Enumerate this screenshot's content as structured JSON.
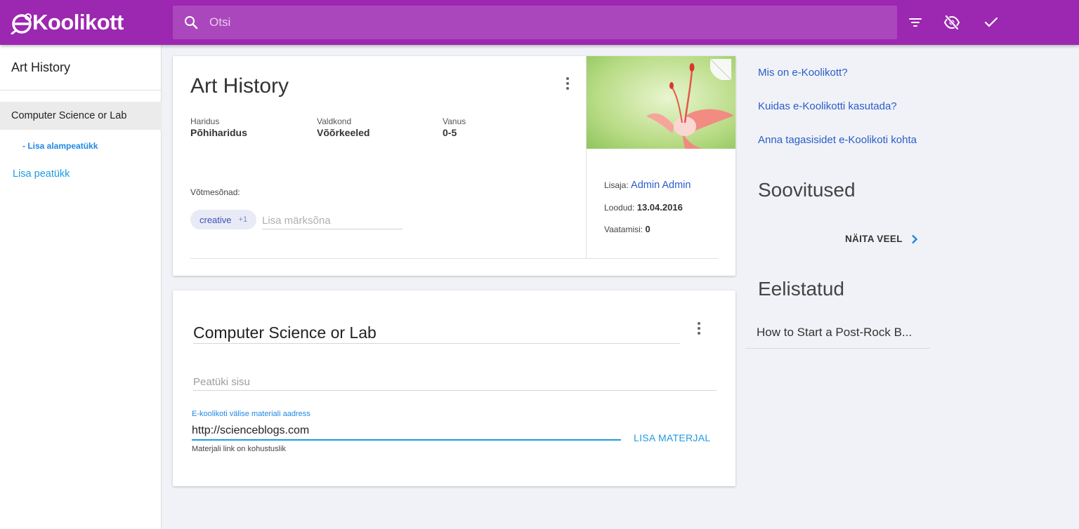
{
  "header": {
    "logo_text": "Koolikott",
    "search_placeholder": "Otsi",
    "colors": {
      "primary": "#9c27b0",
      "search_bg": "#ab47bc"
    },
    "icons": [
      "search-icon",
      "filter-icon",
      "visibility-off-icon",
      "check-icon"
    ]
  },
  "sidebar": {
    "title": "Art History",
    "chapter": "Computer Science or Lab",
    "add_subchapter": "- Lisa alampeatükk",
    "add_chapter": "Lisa peatükk"
  },
  "material": {
    "title": "Art History",
    "fields": [
      {
        "label": "Haridus",
        "value": "Põhiharidus"
      },
      {
        "label": "Valdkond",
        "value": "Võõrkeeled"
      },
      {
        "label": "Vanus",
        "value": "0-5"
      }
    ],
    "keywords_label": "Võtmesõnad:",
    "keyword_chip": "creative",
    "keyword_more": "+1",
    "keyword_placeholder": "Lisa märksõna",
    "added_by_label": "Lisaja:",
    "added_by": "Admin Admin",
    "created_label": "Loodud:",
    "created": "13.04.2016",
    "views_label": "Vaatamisi:",
    "views": "0"
  },
  "chapter": {
    "title": "Computer Science or Lab",
    "content_placeholder": "Peatüki sisu",
    "url_label": "E-koolikoti välise materiali aadress",
    "url_value": "http://scienceblogs.com",
    "url_hint": "Materjali link on kohustuslik",
    "add_button": "LISA MATERJAL"
  },
  "right": {
    "links": [
      "Mis on e-Koolikott?",
      "Kuidas e-Koolikotti kasutada?",
      "Anna tagasisidet e-Koolikoti kohta"
    ],
    "recommendations_heading": "Soovitused",
    "show_more": "NÄITA VEEL",
    "favorites_heading": "Eelistatud",
    "favorite_item": "How to Start a Post-Rock B..."
  }
}
